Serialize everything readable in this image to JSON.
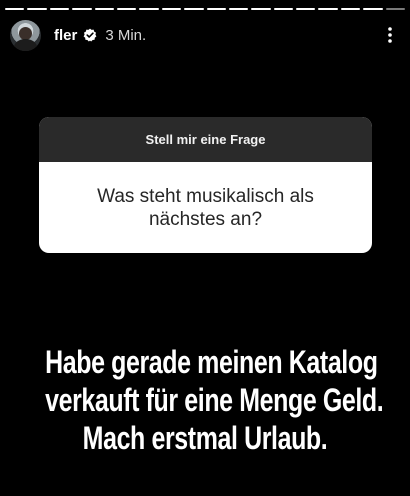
{
  "story": {
    "progress_segments": 18,
    "progress_viewed": 17
  },
  "header": {
    "username": "fler",
    "verified": true,
    "time": "3 Min.",
    "more_icon": "more-vertical-icon"
  },
  "question_sticker": {
    "title": "Stell mir eine Frage",
    "question": "Was steht musikalisch als nächstes an?"
  },
  "answer": {
    "lines": [
      "Habe gerade meinen Katalog",
      "verkauft für eine Menge Geld.",
      "Mach erstmal Urlaub."
    ]
  }
}
